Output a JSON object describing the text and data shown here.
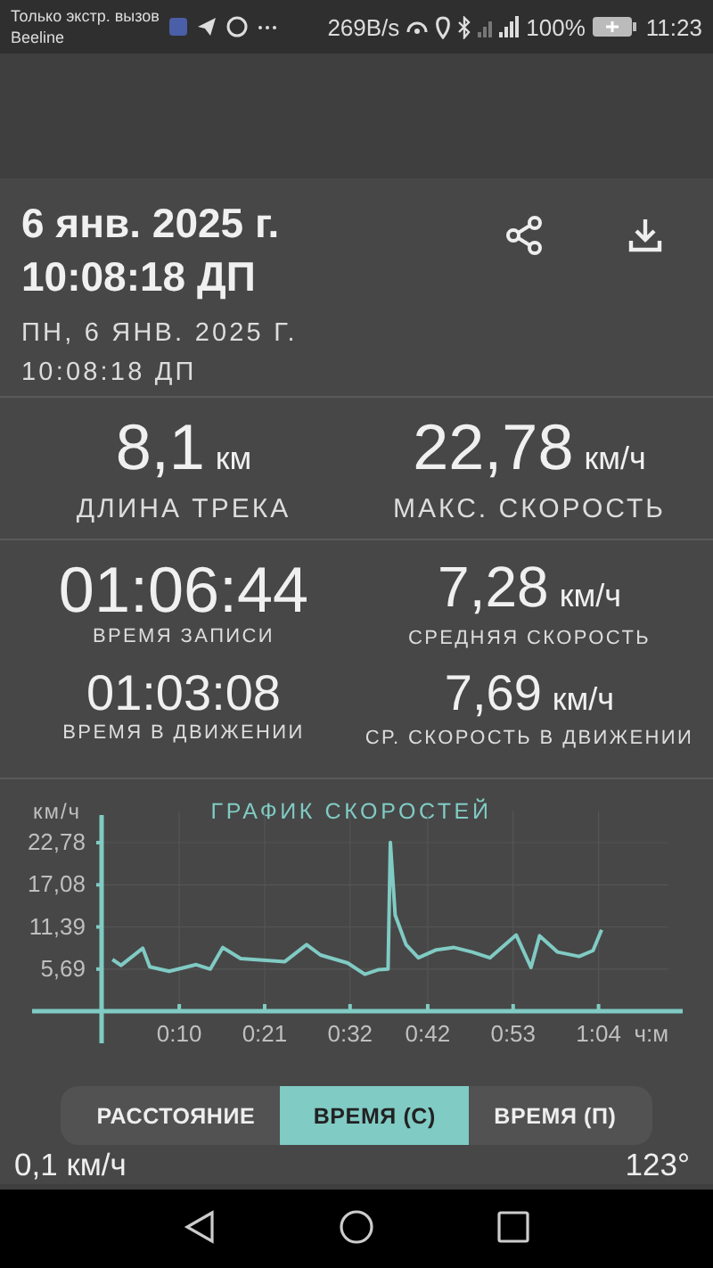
{
  "status_bar": {
    "carrier_line1": "Только экстр. вызов",
    "carrier_line2": "Beeline",
    "speed": "269B/s",
    "battery": "100%",
    "time": "11:23"
  },
  "header": {
    "title_lines": [
      "6 янв. 2025 г.",
      "10:08:18 ДП"
    ],
    "subtitle_lines": [
      "ПН, 6 ЯНВ. 2025 Г.",
      "10:08:18 ДП"
    ]
  },
  "summary": [
    {
      "value": "8,1",
      "unit": "км",
      "label": "ДЛИНА ТРЕКА"
    },
    {
      "value": "22,78",
      "unit": "км/ч",
      "label": "МАКС. СКОРОСТЬ"
    }
  ],
  "details": [
    {
      "value": "01:06:44",
      "label": "ВРЕМЯ ЗАПИСИ"
    },
    {
      "value": "7,28",
      "unit": "км/ч",
      "label": "СРЕДНЯЯ СКОРОСТЬ"
    },
    {
      "value": "01:03:08",
      "label": "ВРЕМЯ В ДВИЖЕНИИ"
    },
    {
      "value": "7,69",
      "unit": "км/ч",
      "label": "СР. СКОРОСТЬ В ДВИЖЕНИИ"
    }
  ],
  "speed_chart": {
    "chart_data": {
      "type": "line",
      "title": "ГРАФИК СКОРОСТЕЙ",
      "xlabel": "ч:м",
      "ylabel": "км/ч",
      "x": [
        1.4,
        2.5,
        5.3,
        6.2,
        8.7,
        12.2,
        14,
        15.6,
        17.9,
        23.6,
        26.4,
        28.2,
        31.7,
        33.9,
        35.6,
        36.9,
        37.2,
        37.8,
        39.2,
        40.8,
        43.1,
        45.4,
        47.7,
        50,
        53.4,
        55.3,
        56.4,
        58.7,
        61.5,
        63.3,
        64.4
      ],
      "series": [
        {
          "color": "#80cbc4",
          "values": [
            7.0,
            6.2,
            8.5,
            6.0,
            5.4,
            6.3,
            5.7,
            8.6,
            7.1,
            6.7,
            9.0,
            7.6,
            6.5,
            5.0,
            5.6,
            5.7,
            22.8,
            13,
            9.0,
            7.2,
            8.3,
            8.6,
            8.0,
            7.2,
            10.3,
            5.9,
            10.2,
            8.0,
            7.4,
            8.2,
            11.0
          ]
        }
      ],
      "xlim": [
        0,
        73
      ],
      "ylim": [
        0,
        27
      ],
      "grid": true,
      "xticks": [
        {
          "value": 10,
          "label": "0:10"
        },
        {
          "value": 21,
          "label": "0:21"
        },
        {
          "value": 32,
          "label": "0:32"
        },
        {
          "value": 42,
          "label": "0:42"
        },
        {
          "value": 53,
          "label": "0:53"
        },
        {
          "value": 64,
          "label": "1:04"
        }
      ],
      "yticks": [
        {
          "value": 5.69,
          "label": "5,69"
        },
        {
          "value": 11.39,
          "label": "11,39"
        },
        {
          "value": 17.08,
          "label": "17,08"
        },
        {
          "value": 22.78,
          "label": "22,78"
        }
      ]
    }
  },
  "axis_tabs": [
    {
      "label": "РАССТОЯНИЕ",
      "selected": false
    },
    {
      "label": "ВРЕМЯ (С)",
      "selected": true
    },
    {
      "label": "ВРЕМЯ (П)",
      "selected": false
    }
  ],
  "footer": {
    "current_speed": "0,1 км/ч",
    "bearing": "123°"
  }
}
